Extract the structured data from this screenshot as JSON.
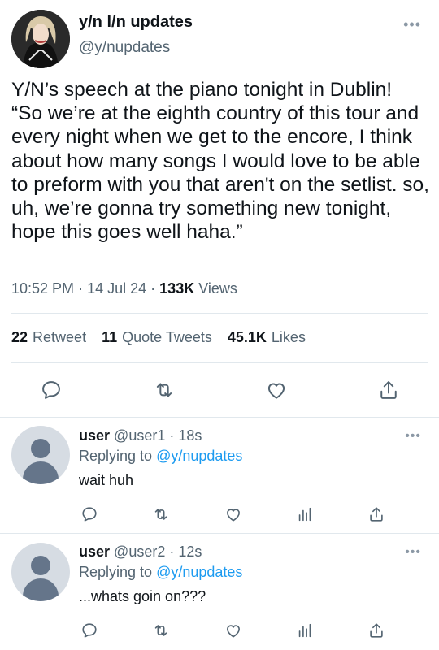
{
  "tweet": {
    "display_name": "y/n l/n updates",
    "handle": "@y/nupdates",
    "text": "Y/N’s speech at the piano tonight in Dublin!\n“So we’re at the eighth country of this tour and every night when we get to the encore, I think about how many songs I would love to be able to preform with you that aren't on the setlist. so, uh, we’re gonna try something new tonight, hope this goes well haha.”",
    "time": "10:52 PM",
    "date": "14 Jul 24",
    "views_count": "133K",
    "views_label": "Views",
    "stats": {
      "retweets_count": "22",
      "retweets_label": "Retweet",
      "quotes_count": "11",
      "quotes_label": "Quote Tweets",
      "likes_count": "45.1K",
      "likes_label": "Likes"
    },
    "more_icon": "more-dots-icon"
  },
  "replies": [
    {
      "name": "user",
      "handle": "@user1",
      "time": "18s",
      "replying_label": "Replying to",
      "replying_to": "@y/nupdates",
      "text": "wait huh"
    },
    {
      "name": "user",
      "handle": "@user2",
      "time": "12s",
      "replying_label": "Replying to",
      "replying_to": "@y/nupdates",
      "text": "...whats goin on???"
    }
  ],
  "separator": "·",
  "colors": {
    "text": "#0f1419",
    "secondary": "#536471",
    "accent": "#1d9bf0",
    "icon": "#536471",
    "divider": "#e1e8ed"
  }
}
